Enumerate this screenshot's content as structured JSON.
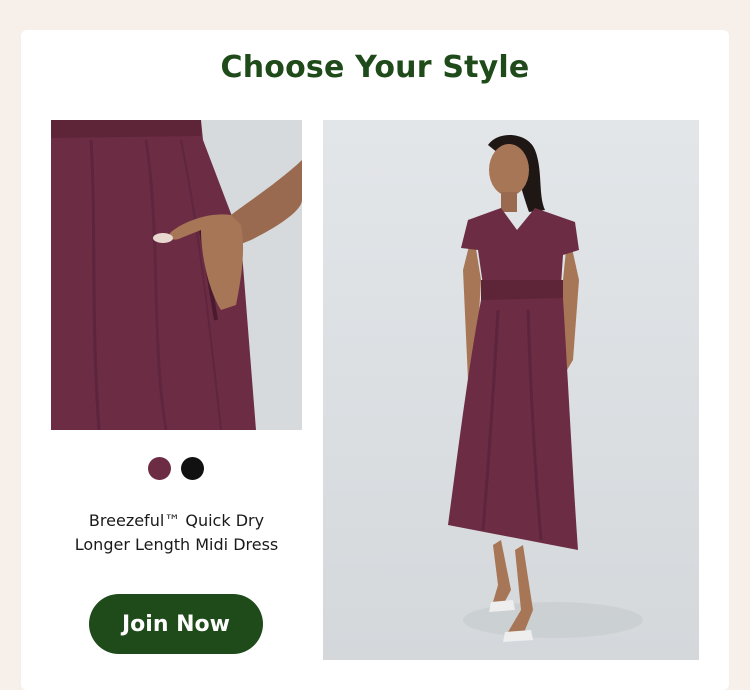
{
  "header": {
    "title": "Choose Your Style"
  },
  "product": {
    "name_line1": "Breezeful™ Quick Dry",
    "name_line2": "Longer Length Midi Dress",
    "swatches": [
      {
        "name": "plum",
        "color": "#6c2c44"
      },
      {
        "name": "black",
        "color": "#111111"
      }
    ]
  },
  "cta": {
    "label": "Join Now"
  },
  "colors": {
    "brand_green": "#1f4a1a",
    "dress": "#6c2c44",
    "page_bg": "#f7f0ea"
  }
}
